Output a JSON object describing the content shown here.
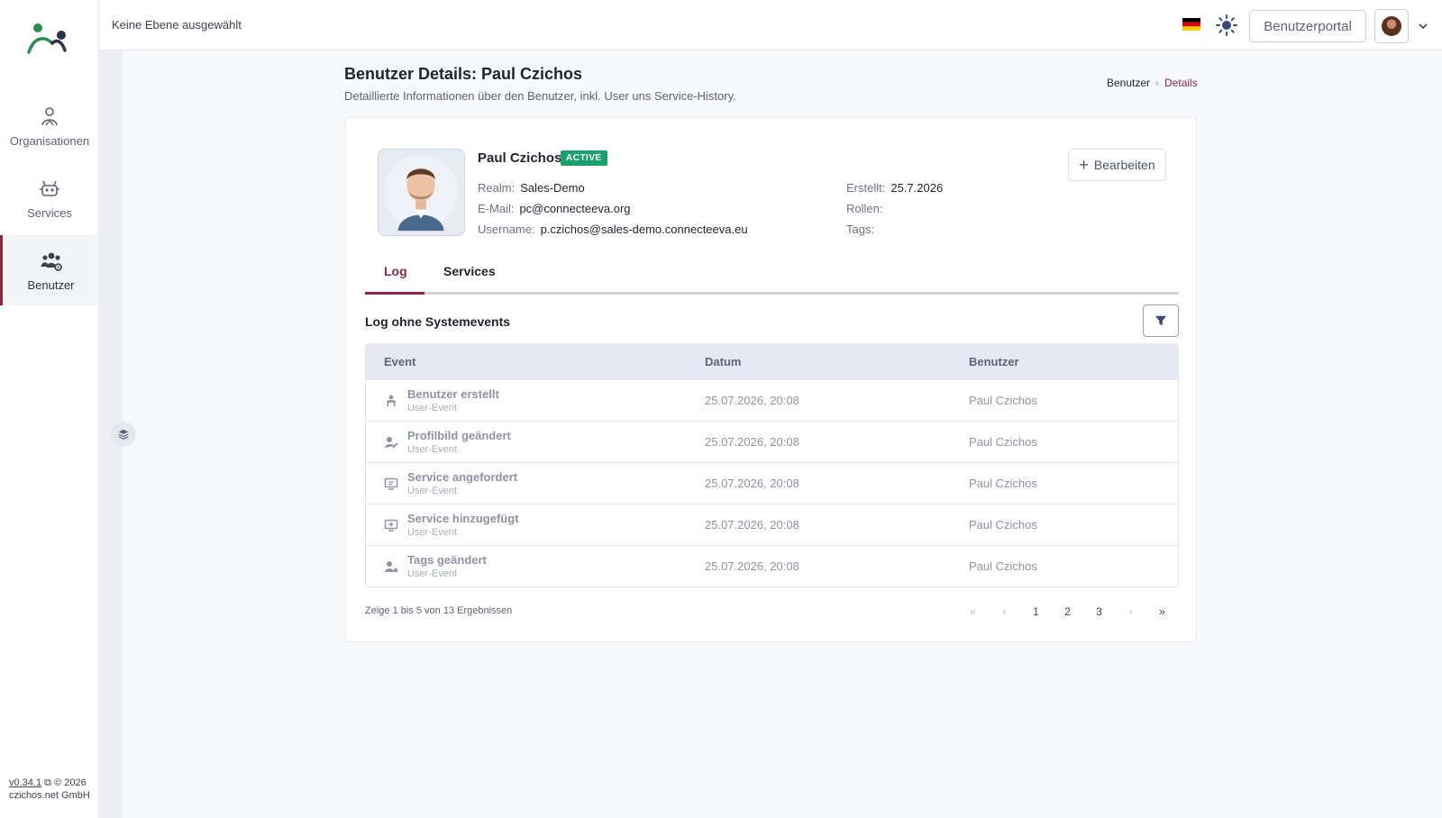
{
  "sidebar": {
    "items": [
      {
        "label": "Organisationen",
        "icon": "organization-icon"
      },
      {
        "label": "Services",
        "icon": "robot-icon"
      },
      {
        "label": "Benutzer",
        "icon": "users-gear-icon",
        "active": true
      }
    ],
    "footer": {
      "version": "v0.34.1",
      "copyright": "© 2026",
      "company": "czichos.net GmbH"
    }
  },
  "topbar": {
    "level": "Keine Ebene ausgewählt",
    "portal_button": "Benutzerportal",
    "language_flag": "de-flag-icon",
    "theme_icon": "sun-icon"
  },
  "page": {
    "title": "Benutzer Details: Paul Czichos",
    "subtitle": "Detaillierte Informationen über den Benutzer, inkl. User uns Service-History.",
    "breadcrumb": [
      "Benutzer",
      "Details"
    ]
  },
  "user": {
    "name": "Paul Czichos",
    "status": "ACTIVE",
    "realm_label": "Realm:",
    "realm": "Sales-Demo",
    "email_label": "E-Mail:",
    "email": "pc@connecteeva.org",
    "username_label": "Username:",
    "username": "p.czichos@sales-demo.connecteeva.eu",
    "created_label": "Erstellt:",
    "created": "25.7.2026",
    "roles_label": "Rollen:",
    "roles": "",
    "tags_label": "Tags:",
    "tags": "",
    "edit_button": "Bearbeiten"
  },
  "tabs": [
    {
      "label": "Log",
      "active": true
    },
    {
      "label": "Services"
    }
  ],
  "log": {
    "title": "Log ohne Systemevents",
    "columns": [
      "Event",
      "Datum",
      "Benutzer"
    ],
    "rows": [
      {
        "icon": "user-plus-icon",
        "event": "Benutzer erstellt",
        "type": "User-Event",
        "date": "25.07.2026, 20:08",
        "user": "Paul Czichos"
      },
      {
        "icon": "user-edit-icon",
        "event": "Profilbild geändert",
        "type": "User-Event",
        "date": "25.07.2026, 20:08",
        "user": "Paul Czichos"
      },
      {
        "icon": "monitor-icon",
        "event": "Service angefordert",
        "type": "User-Event",
        "date": "25.07.2026, 20:08",
        "user": "Paul Czichos"
      },
      {
        "icon": "monitor-add-icon",
        "event": "Service hinzugefügt",
        "type": "User-Event",
        "date": "25.07.2026, 20:08",
        "user": "Paul Czichos"
      },
      {
        "icon": "user-tag-icon",
        "event": "Tags geändert",
        "type": "User-Event",
        "date": "25.07.2026, 20:08",
        "user": "Paul Czichos"
      }
    ],
    "result_text": "Zeige 1 bis 5 von 13 Ergebnissen",
    "pagination": {
      "first": "«",
      "prev": "‹",
      "pages": [
        "1",
        "2",
        "3"
      ],
      "next": "›",
      "last": "»"
    }
  },
  "colors": {
    "accent": "#8a2846",
    "badge": "#1aa06d"
  }
}
